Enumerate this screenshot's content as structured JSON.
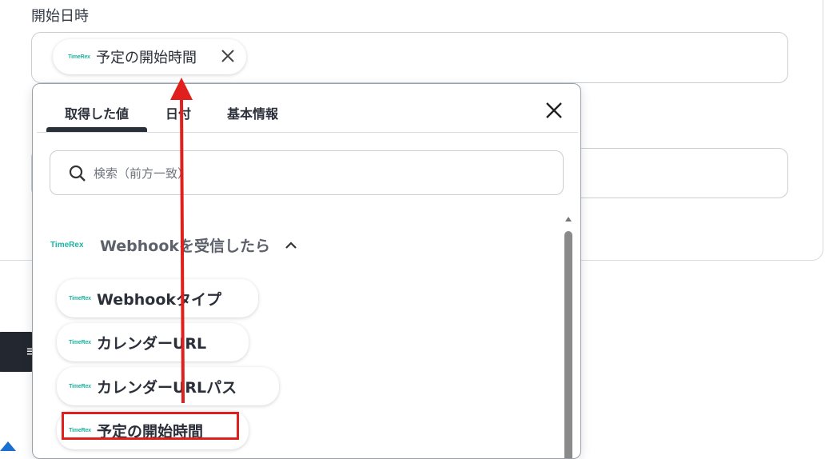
{
  "field": {
    "label": "開始日時",
    "selected_chip": {
      "logo": "TimeRex",
      "label": "予定の開始時間"
    },
    "remove_icon": "close-icon"
  },
  "popover": {
    "tabs": [
      {
        "label": "取得した値",
        "active": true
      },
      {
        "label": "日付",
        "active": false
      },
      {
        "label": "基本情報",
        "active": false
      }
    ],
    "search": {
      "placeholder": "検索（前方一致）"
    },
    "group": {
      "logo": "TimeRex",
      "title": "Webhookを受信したら",
      "expanded": true,
      "items": [
        {
          "logo": "TimeRex",
          "label": "Webhookタイプ"
        },
        {
          "logo": "TimeRex",
          "label": "カレンダーURL"
        },
        {
          "logo": "TimeRex",
          "label": "カレンダーURLパス"
        },
        {
          "logo": "TimeRex",
          "label": "予定の開始時間"
        }
      ]
    }
  },
  "colors": {
    "annotation_red": "#e0201c",
    "brand_teal": "#1fb3a0",
    "text_dark": "#2b2f3a"
  },
  "icons": {
    "close": "close-icon",
    "search": "search-icon",
    "collapse": "chevron-up-icon"
  }
}
